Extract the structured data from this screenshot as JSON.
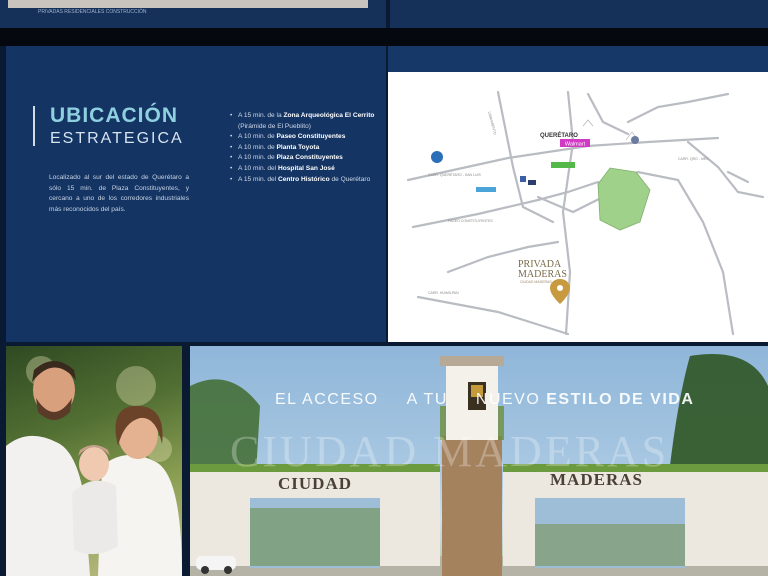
{
  "top": {
    "caption": "PRIVADAS RESIDENCIALES CONSTRUCCIÓN"
  },
  "section": {
    "title_line1": "UBICACIÓN",
    "title_line2": "ESTRATEGICA",
    "description": "Localizado al sur del estado de Querétaro a sólo 15 min. de Plaza Constituyentes, y cercano a uno de los corredores industriales más reconocidos del país."
  },
  "bullets": [
    {
      "prefix": "A 15 min. de la ",
      "bold": "Zona Arqueológica El Cerrito",
      "suffix": " (Pirámide de El Pueblito)"
    },
    {
      "prefix": "A 10 min. de ",
      "bold": "Paseo Constituyentes",
      "suffix": ""
    },
    {
      "prefix": "A 10 min. de ",
      "bold": "Planta Toyota",
      "suffix": ""
    },
    {
      "prefix": "A 10 min. de ",
      "bold": "Plaza Constituyentes",
      "suffix": ""
    },
    {
      "prefix": "A 10 min. del ",
      "bold": "Hospital San José",
      "suffix": ""
    },
    {
      "prefix": "A 15 min. del ",
      "bold": "Centro Histórico",
      "suffix": " de Querétaro"
    }
  ],
  "map": {
    "city_label": "QUERÉTARO",
    "brand_line1": "PRIVADA",
    "brand_line2": "MADERAS",
    "brand_tag": "CIUDAD MADERAS",
    "road_labels": [
      "CARR. QUERÉTARO - SAN LUIS",
      "LIBRAMIENTO",
      "CARR. QRO - MÉX",
      "PASEO CONSTITUYENTES",
      "CARR. HUIMILPAN"
    ],
    "badge_label": "Walmart"
  },
  "hero": {
    "slogan_part1": "EL ACCESO",
    "slogan_part2": "A TU",
    "slogan_part3": "NUEVO",
    "slogan_bold": "ESTILO DE VIDA",
    "watermark": "CIUDAD MADERAS",
    "sign_left": "CIUDAD",
    "sign_right": "MADERAS"
  },
  "colors": {
    "navy": "#143463",
    "accent_cyan": "#8fd0e0",
    "park_green": "#9fd18b"
  }
}
